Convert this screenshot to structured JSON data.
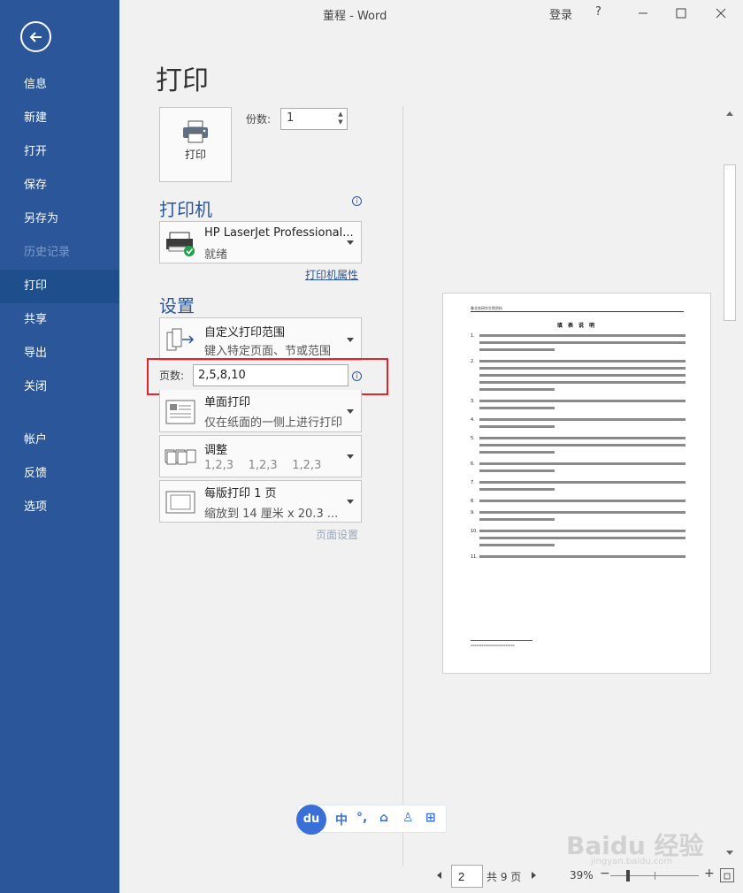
{
  "window": {
    "title": "董程  -  Word",
    "signin": "登录",
    "help": "?"
  },
  "nav": {
    "items": [
      {
        "label": "信息",
        "state": "normal"
      },
      {
        "label": "新建",
        "state": "normal"
      },
      {
        "label": "打开",
        "state": "normal"
      },
      {
        "label": "保存",
        "state": "normal"
      },
      {
        "label": "另存为",
        "state": "normal"
      },
      {
        "label": "历史记录",
        "state": "disabled"
      },
      {
        "label": "打印",
        "state": "active"
      },
      {
        "label": "共享",
        "state": "normal"
      },
      {
        "label": "导出",
        "state": "normal"
      },
      {
        "label": "关闭",
        "state": "normal"
      },
      {
        "label": "帐户",
        "state": "normal"
      },
      {
        "label": "反馈",
        "state": "normal"
      },
      {
        "label": "选项",
        "state": "normal"
      }
    ]
  },
  "print": {
    "heading": "打印",
    "button_label": "打印",
    "copies_label": "份数:",
    "copies_value": "1"
  },
  "printer": {
    "heading": "打印机",
    "name": "HP LaserJet Professional...",
    "status": "就绪",
    "properties_link": "打印机属性"
  },
  "settings": {
    "heading": "设置",
    "range": {
      "title": "自定义打印范围",
      "subtitle": "键入特定页面、节或范围"
    },
    "pages_label": "页数:",
    "pages_value": "2,5,8,10",
    "sides": {
      "title": "单面打印",
      "subtitle": "仅在纸面的一侧上进行打印"
    },
    "collate": {
      "title": "调整",
      "subtitle": "1,2,3    1,2,3    1,2,3"
    },
    "per_sheet": {
      "title": "每版打印 1 页",
      "subtitle": "缩放到 14 厘米 x 20.3 ..."
    },
    "page_setup_link": "页面设置"
  },
  "preview": {
    "header": "鲁北农研究生院资料",
    "title": "填 表 说 明",
    "items": [
      "1.",
      "2.",
      "3.",
      "4.",
      "5.",
      "6.",
      "7.",
      "8.",
      "9.",
      "10.",
      "11."
    ],
    "footer": "xxxxxxxxxxxxxxxxxxxxxxxx"
  },
  "pager": {
    "current_page": "2",
    "total": "共 9 页",
    "zoom": "39%",
    "zoom_minus": "−",
    "zoom_plus": "+"
  },
  "ime": {
    "logo": "du",
    "items": [
      "中",
      "°,",
      "⌂",
      "♙",
      "⊞"
    ]
  },
  "watermark": {
    "text": "Baidu 经验",
    "sub": "jingyan.baidu.com"
  },
  "colors": {
    "accent": "#2b579a",
    "highlight": "#e3242b"
  }
}
